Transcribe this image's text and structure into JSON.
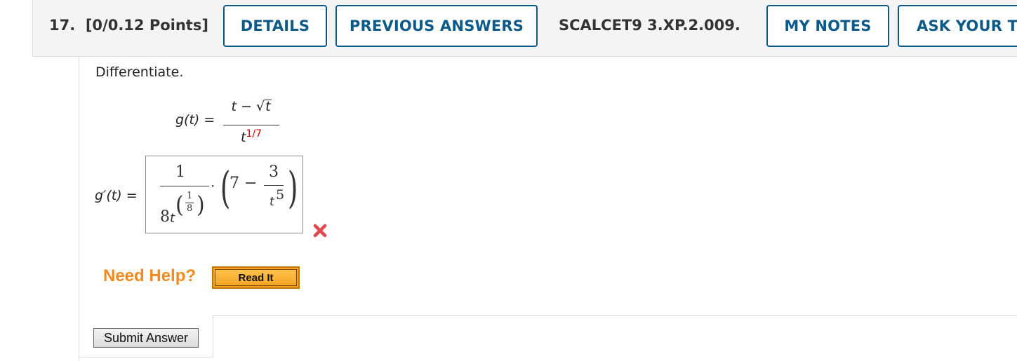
{
  "question": {
    "number": "17.",
    "points": "[0/0.12 Points]",
    "code": "SCALCET9 3.XP.2.009."
  },
  "header_buttons": {
    "details": "DETAILS",
    "previous_answers": "PREVIOUS ANSWERS",
    "my_notes": "MY NOTES",
    "ask_teacher": "ASK YOUR TEACHER"
  },
  "prompt": "Differentiate.",
  "function": {
    "lhs": "g(t) =",
    "numerator_t": "t",
    "numerator_minus": "−",
    "numerator_sqrt_arg": "t",
    "denominator_base": "t",
    "denominator_exponent": "1/7"
  },
  "answer": {
    "label": "g′(t) =",
    "outer_numerator": "1",
    "outer_den_coeff": "8",
    "outer_den_var": "t",
    "exp_num": "1",
    "exp_den": "8",
    "dot": "·",
    "inner_const": "7",
    "inner_minus": "−",
    "inner_num": "3",
    "inner_den_var": "t",
    "inner_den_exp": "5",
    "status": "incorrect"
  },
  "help": {
    "label": "Need Help?",
    "read_it": "Read It"
  },
  "submit_label": "Submit Answer",
  "colors": {
    "accent": "#0c5a8a",
    "help_orange": "#f28a1e",
    "wrong_red": "#e0474c",
    "exponent_red": "#c00000"
  }
}
